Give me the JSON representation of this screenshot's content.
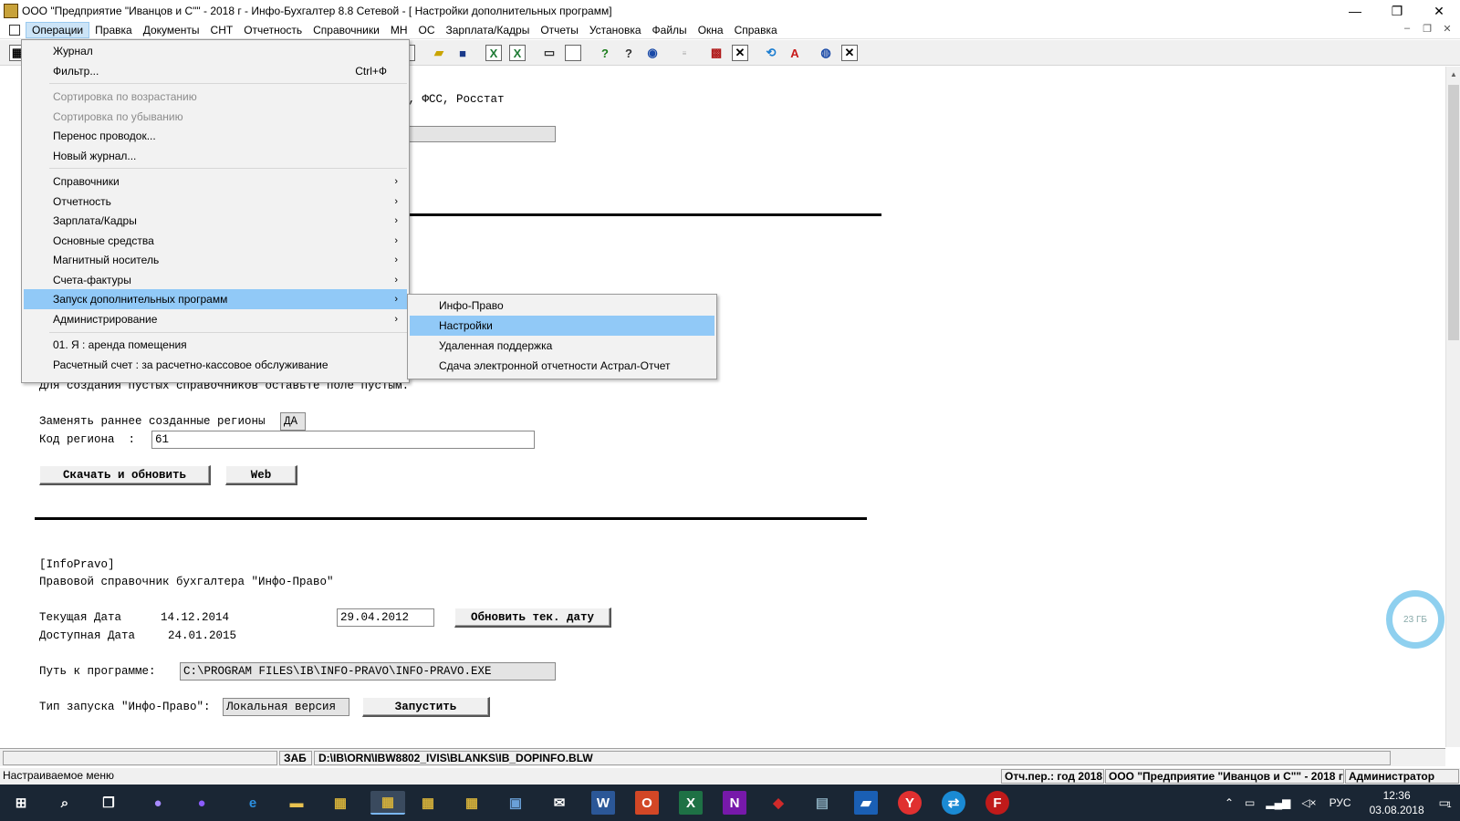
{
  "window": {
    "title": "ООО \"Предприятие \"Иванцов и С\"\" - 2018 г - Инфо-Бухгалтер 8.8 Сетевой - [ Настройки дополнительных программ]",
    "minimize_glyph": "—",
    "restore_glyph": "❐",
    "close_glyph": "✕"
  },
  "menubar": {
    "items": [
      "Операции",
      "Правка",
      "Документы",
      "СНТ",
      "Отчетность",
      "Справочники",
      "МН",
      "ОС",
      "Зарплата/Кадры",
      "Отчеты",
      "Установка",
      "Файлы",
      "Окна",
      "Справка"
    ],
    "mdi_min": "–",
    "mdi_restore": "❐",
    "mdi_close": "✕"
  },
  "toolbar": {
    "icons": [
      "journal-icon",
      "open-folder-icon",
      "save-icon",
      "excel-export-icon",
      "excel-icon",
      "print-icon",
      "preview-icon",
      "help-icon",
      "context-help-icon",
      "compass-icon",
      "report-icon",
      "calc-icon",
      "close-x-icon",
      "teamviewer-icon",
      "astral-icon",
      "globe-icon",
      "close-x2-icon"
    ],
    "glyphs": [
      "▦",
      "📂",
      "💾",
      "X",
      "X",
      "🖶",
      "▤",
      "?",
      "?",
      "✪",
      "",
      "▩",
      "✕",
      "⟲",
      "A",
      "◍",
      "✕"
    ]
  },
  "document": {
    "header_fragment": "Р, ФСС, Росстат",
    "empty_hint": "Для создания пустых справочников оставьте поле пустым.",
    "replace_label": "Заменять раннее созданные регионы",
    "replace_value": "ДА",
    "region_label": "Код региона  :",
    "region_value": "61",
    "download_button": "Скачать и обновить",
    "web_button": "Web",
    "infopravo_tag": "[InfoPravo]",
    "infopravo_desc": "Правовой справочник бухгалтера \"Инфо-Право\"",
    "current_date_label": "Текущая Дата",
    "current_date_value": "14.12.2014",
    "current_date_field": "29.04.2012",
    "update_date_button": "Обновить тек. дату",
    "available_date_label": "Доступная Дата",
    "available_date_value": "24.01.2015",
    "path_label": "Путь к программе:",
    "path_value": "C:\\PROGRAM FILES\\IB\\INFO-PRAVO\\INFO-PRAVO.EXE",
    "launch_type_label": "Тип запуска \"Инфо-Право\":",
    "launch_type_value": "Локальная версия",
    "launch_button": "Запустить"
  },
  "pathbar": {
    "mode": "ЗАБ",
    "file": "D:\\IB\\ORN\\IBW8802_IVIS\\BLANKS\\IB_DOPINFO.BLW"
  },
  "statusbar": {
    "hint": "Настраиваемое меню",
    "period": "Отч.пер.: год 2018",
    "org": "ООО \"Предприятие \"Иванцов и С\"\" - 2018 г",
    "user": "Администратор"
  },
  "disk_widget": "23 ГБ",
  "menu": {
    "group1": [
      {
        "label": "Журнал",
        "shortcut": ""
      },
      {
        "label": "Фильтр...",
        "shortcut": "Ctrl+Ф"
      }
    ],
    "group2": [
      {
        "label": "Сортировка по возрастанию",
        "disabled": true
      },
      {
        "label": "Сортировка по убыванию",
        "disabled": true
      },
      {
        "label": "Перенос проводок...",
        "disabled": false
      },
      {
        "label": "Новый журнал...",
        "disabled": false
      }
    ],
    "group3": [
      "Справочники",
      "Отчетность",
      "Зарплата/Кадры",
      "Основные средства",
      "Магнитный носитель",
      "Счета-фактуры",
      "Запуск дополнительных программ",
      "Администрирование"
    ],
    "group4": [
      "01. Я : аренда помещения",
      "Расчетный счет : за расчетно-кассовое обслуживание"
    ],
    "submenu_arrow": "›"
  },
  "submenu": {
    "items": [
      "Инфо-Право",
      "Настройки",
      "Удаленная поддержка",
      "Сдача электронной отчетности Астрал-Отчет"
    ]
  },
  "taskbar": {
    "time": "12:36",
    "date": "03.08.2018",
    "lang": "РУС",
    "notif_count": "1",
    "apps": [
      "start",
      "search",
      "task-view",
      "cortana",
      "alice",
      "edge",
      "explorer",
      "calc1",
      "ib-app",
      "calc2",
      "calc3",
      "remote",
      "mail",
      "word",
      "outlook",
      "excel",
      "onenote",
      "astral",
      "desktop",
      "chat",
      "yandex",
      "teamviewer",
      "filezilla"
    ]
  },
  "colors": {
    "menu_highlight": "#91c9f7",
    "taskbar": "#1a2634",
    "disk_ring": "#8fd0ef"
  }
}
